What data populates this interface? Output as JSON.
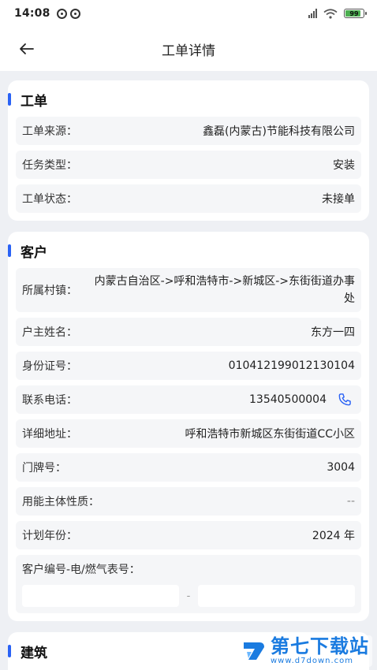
{
  "status_bar": {
    "time": "14:08",
    "battery": "99"
  },
  "nav": {
    "title": "工单详情"
  },
  "sections": {
    "order": {
      "title": "工单",
      "source_label": "工单来源：",
      "source_value": "鑫磊(内蒙古)节能科技有限公司",
      "task_type_label": "任务类型：",
      "task_type_value": "安装",
      "status_label": "工单状态：",
      "status_value": "未接单"
    },
    "customer": {
      "title": "客户",
      "village_label": "所属村镇：",
      "village_value": "内蒙古自治区->呼和浩特市->新城区->东街街道办事处",
      "owner_label": "户主姓名：",
      "owner_value": "东方一四",
      "id_label": "身份证号：",
      "id_value": "010412199012130104",
      "phone_label": "联系电话：",
      "phone_value": "13540500004",
      "address_label": "详细地址：",
      "address_value": "呼和浩特市新城区东街街道CC小区",
      "door_label": "门牌号：",
      "door_value": "3004",
      "nature_label": "用能主体性质：",
      "nature_value": "--",
      "plan_year_label": "计划年份：",
      "plan_year_value": "2024 年",
      "meter_label": "客户编号-电/燃气表号：",
      "meter_electric_value": "",
      "meter_gas_value": "",
      "meter_separator": "-"
    },
    "building": {
      "title": "建筑"
    }
  },
  "watermark": {
    "text": "第七下载站",
    "url": "www.d7down.com"
  },
  "colors": {
    "accent": "#2a62f5",
    "background": "#eef0f4",
    "row_bg": "#f5f6f8"
  },
  "icons": {
    "back": "arrow-left-icon",
    "phone": "phone-icon"
  }
}
